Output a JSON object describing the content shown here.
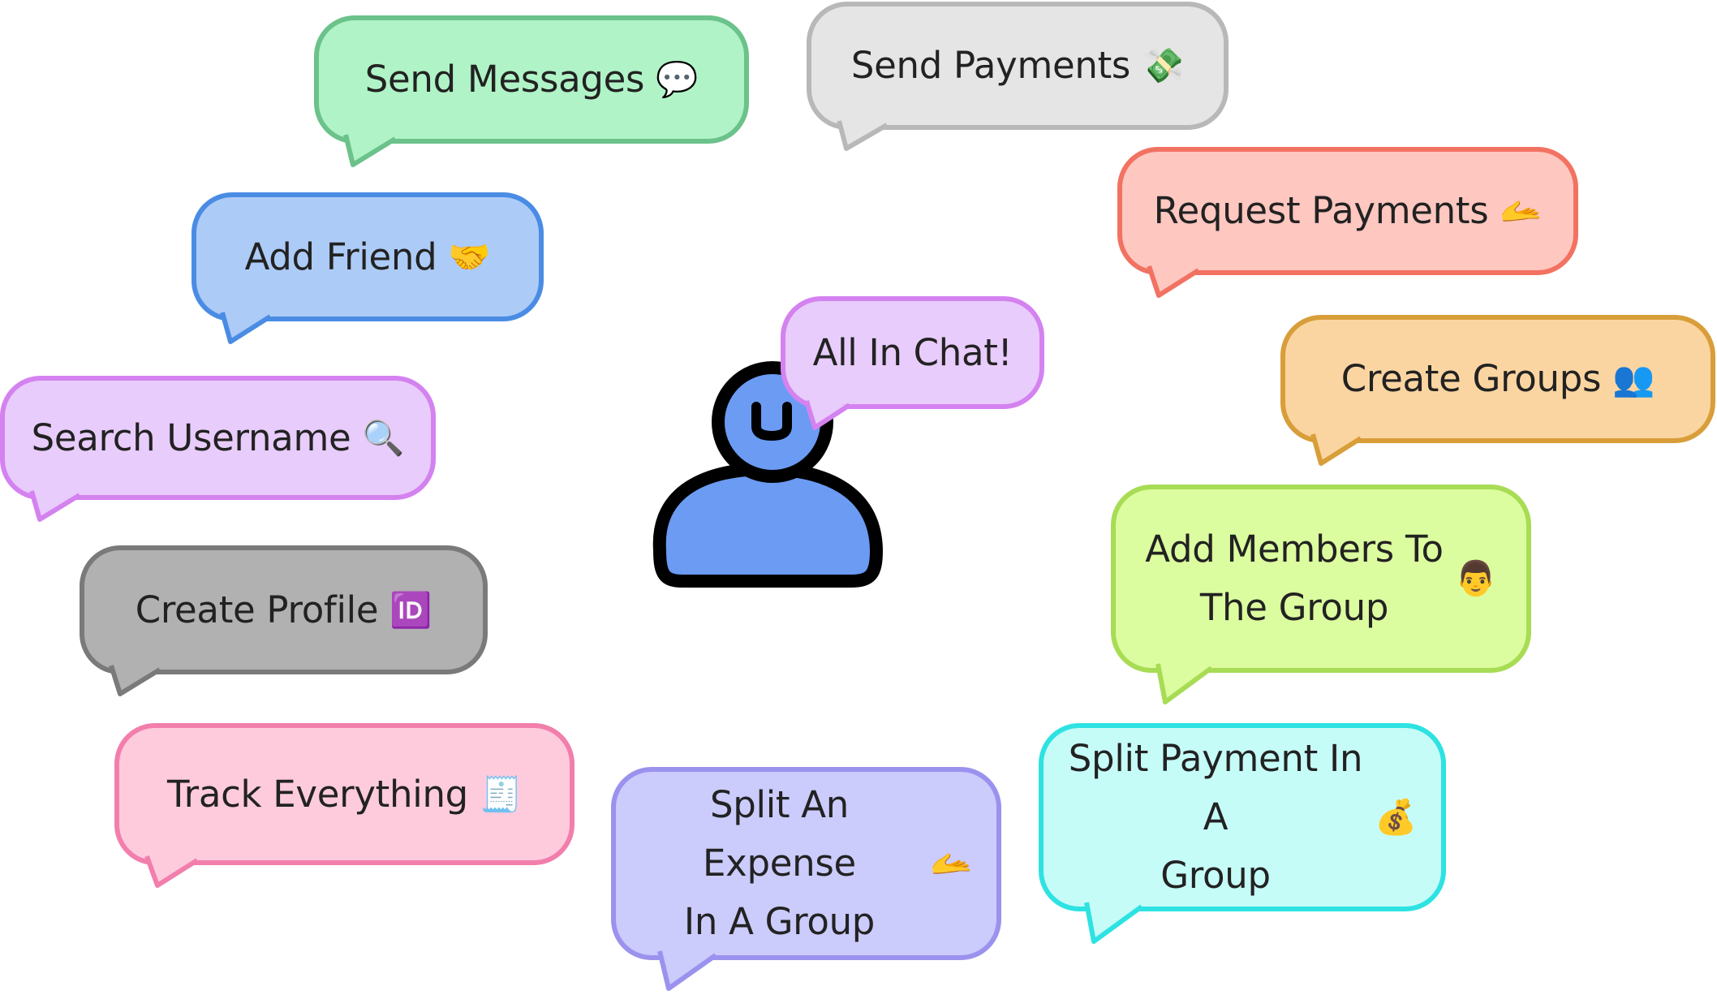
{
  "center": {
    "avatar_icon": "user-icon",
    "avatar_fill": "#6B9BF3",
    "avatar_stroke": "#000000",
    "speech": "All In Chat!"
  },
  "features": [
    {
      "key": "send_messages",
      "text": "Send Messages",
      "emoji": "💬",
      "fill": "#B0F3C7",
      "stroke": "#6BC28A"
    },
    {
      "key": "send_payments",
      "text": "Send Payments",
      "emoji": "💸",
      "fill": "#E5E5E5",
      "stroke": "#B8B8B8"
    },
    {
      "key": "request_payments",
      "text": "Request Payments",
      "emoji": "🫴",
      "fill": "#FEC7C0",
      "stroke": "#F27262"
    },
    {
      "key": "add_friend",
      "text": "Add Friend",
      "emoji": "🤝",
      "fill": "#ADCBF7",
      "stroke": "#4A8CE4"
    },
    {
      "key": "search_username",
      "text": "Search Username",
      "emoji": "🔍",
      "fill": "#E8CCFB",
      "stroke": "#D482F0"
    },
    {
      "key": "create_groups",
      "text": "Create Groups",
      "emoji": "👥",
      "fill": "#FBD5A1",
      "stroke": "#D89E3A"
    },
    {
      "key": "create_profile",
      "text": "Create Profile",
      "emoji": "🆔",
      "fill": "#B1B1B1",
      "stroke": "#7A7A7A"
    },
    {
      "key": "add_members",
      "text": "Add Members To\nThe Group",
      "emoji": "👨",
      "fill": "#DCFD9F",
      "stroke": "#A7DC54"
    },
    {
      "key": "track_everything",
      "text": "Track Everything",
      "emoji": "🧾",
      "fill": "#FECBDD",
      "stroke": "#F27EAC"
    },
    {
      "key": "split_expense",
      "text": "Split An Expense\nIn A Group",
      "emoji": "🫴",
      "fill": "#CBCBFC",
      "stroke": "#9B92EE"
    },
    {
      "key": "split_payment",
      "text": "Split Payment In A\nGroup",
      "emoji": "💰",
      "fill": "#C6FCF8",
      "stroke": "#2EE2E2"
    }
  ]
}
